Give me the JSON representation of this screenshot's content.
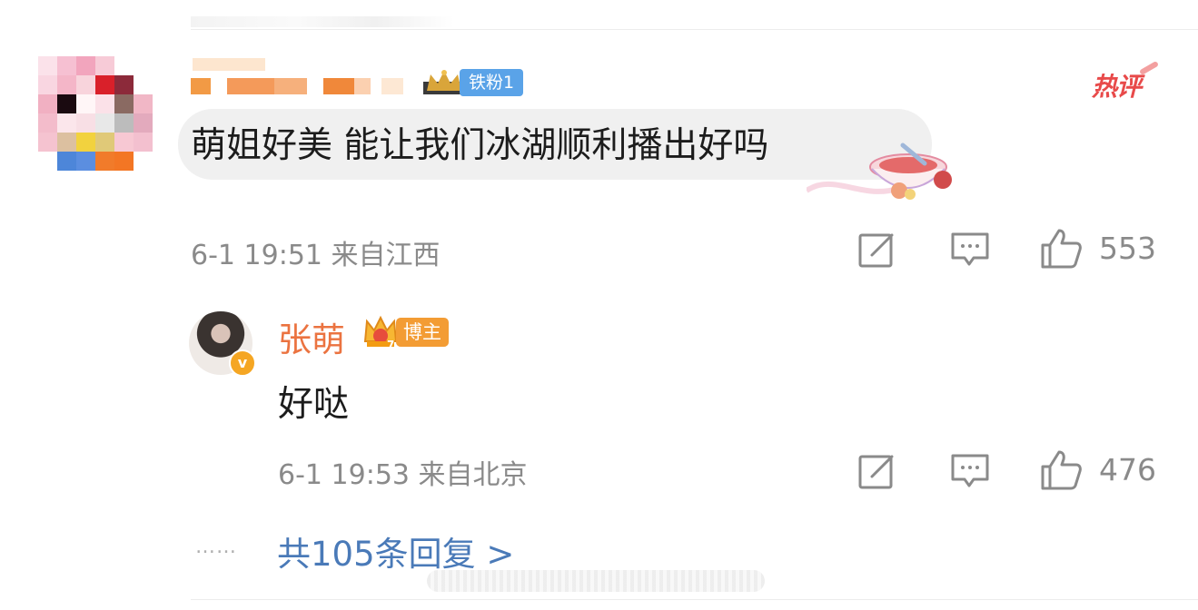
{
  "comment": {
    "fan_badge": "铁粉1",
    "hot_tag": "热评",
    "text": "萌姐好美 能让我们冰湖顺利播出好吗",
    "time": "6-1 19:51",
    "location": "来自江西",
    "likes": "553"
  },
  "reply": {
    "name": "张萌",
    "badge": "博主",
    "crown_level": "7",
    "verified_mark": "v",
    "text": "好哒",
    "time": "6-1 19:53",
    "location": "来自北京",
    "likes": "476"
  },
  "more": {
    "dots": "……",
    "label": "共105条回复 >"
  },
  "colors": {
    "name_orange": "#eb7340",
    "link_blue": "#4a7ab8",
    "hot_red": "#e84a4a",
    "fan_blue": "#5aa3e8",
    "meta_gray": "#8a8a8a"
  },
  "icons": [
    "edit-icon",
    "comment-icon",
    "like-icon",
    "crown-icon",
    "verified-icon"
  ]
}
